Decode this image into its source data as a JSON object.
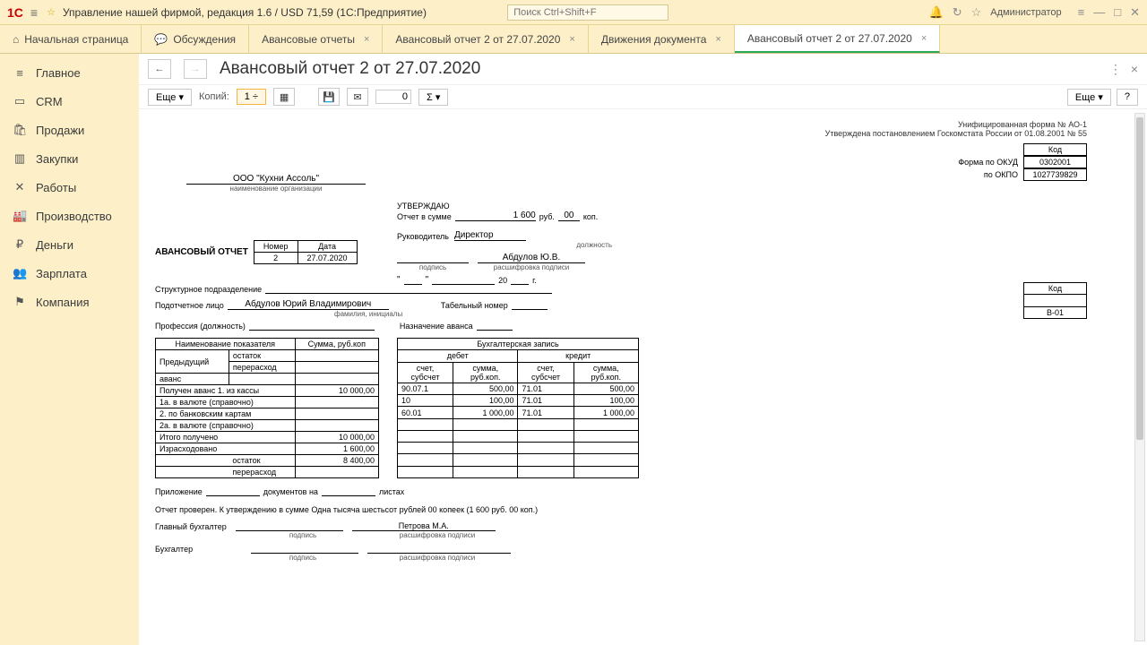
{
  "titlebar": {
    "app_title": "Управление нашей фирмой, редакция 1.6 / USD 71,59  (1С:Предприятие)",
    "search_placeholder": "Поиск Ctrl+Shift+F",
    "user": "Администратор"
  },
  "tabs": {
    "home": "Начальная страница",
    "chat": "Обсуждения",
    "t1": "Авансовые отчеты",
    "t2": "Авансовый отчет 2 от 27.07.2020",
    "t3": "Движения документа",
    "active": "Авансовый отчет 2 от 27.07.2020"
  },
  "sidebar": {
    "main": "Главное",
    "crm": "CRM",
    "sales": "Продажи",
    "purchases": "Закупки",
    "works": "Работы",
    "production": "Производство",
    "money": "Деньги",
    "salary": "Зарплата",
    "company": "Компания"
  },
  "doc": {
    "title": "Авансовый отчет 2 от 27.07.2020",
    "more": "Еще",
    "copies_label": "Копий:",
    "copies_value": "1",
    "zero": "0",
    "sigma": "Σ",
    "help": "?"
  },
  "report": {
    "form_num": "Унифицированная форма № АО-1",
    "form_approved": "Утверждена постановлением Госкомстата России от  01.08.2001 № 55",
    "code_label": "Код",
    "okud_label": "Форма по ОКУД",
    "okud": "0302001",
    "okpo_label": "по ОКПО",
    "okpo": "1027739829",
    "org": "ООО \"Кухни Ассоль\"",
    "org_caption": "наименование организации",
    "approve": "УТВЕРЖДАЮ",
    "sum_label": "Отчет в сумме",
    "sum_val": "1 600",
    "rub": "руб.",
    "kop_val": "00",
    "kop": "коп.",
    "boss_label": "Руководитель",
    "boss_pos": "Директор",
    "pos_caption": "должность",
    "sig_caption": "подпись",
    "decipher_caption": "расшифровка подписи",
    "boss_name": "Абдулов Ю.В.",
    "date20": "20",
    "date_g": "г.",
    "title_main": "АВАНСОВЫЙ ОТЧЕТ",
    "num_label": "Номер",
    "date_label": "Дата",
    "number": "2",
    "date": "27.07.2020",
    "struct_label": "Структурное подразделение",
    "person_label": "Подотчетное лицо",
    "person": "Абдулов Юрий Владимирович",
    "person_caption": "фамилия, инициалы",
    "tabnum_label": "Табельный номер",
    "tabnum": "В-01",
    "prof_label": "Профессия (должность)",
    "purpose_label": "Назначение аванса",
    "left_h1": "Наименование показателя",
    "left_h2": "Сумма, руб.коп",
    "prev": "Предыдущий",
    "prev_ost": "остаток",
    "prev_pere": "перерасход",
    "avans": "аванс",
    "row1": "Получен аванс 1. из кассы",
    "row1_val": "10 000,00",
    "row2": "1а. в валюте (справочно)",
    "row3": "2. по банковским картам",
    "row4": "2а. в валюте (справочно)",
    "row5": "Итого получено",
    "row5_val": "10 000,00",
    "row6": "Израсходовано",
    "row6_val": "1 600,00",
    "row7": "остаток",
    "row7_val": "8 400,00",
    "row8": "перерасход",
    "acc_h": "Бухгалтерская запись",
    "debit": "дебет",
    "credit": "кредит",
    "acc_sub": "счет, субсчет",
    "acc_sum": "сумма, руб.коп.",
    "d1_acc": "90.07.1",
    "d1_sum": "500,00",
    "c1_acc": "71.01",
    "c1_sum": "500,00",
    "d2_acc": "10",
    "d2_sum": "100,00",
    "c2_acc": "71.01",
    "c2_sum": "100,00",
    "d3_acc": "60.01",
    "d3_sum": "1 000,00",
    "c3_acc": "71.01",
    "c3_sum": "1 000,00",
    "attach_label": "Приложение",
    "docs_on": "документов на",
    "sheets": "листах",
    "checked": "Отчет проверен. К утверждению в сумме Одна тысяча шестьсот рублей 00 копеек (1 600 руб. 00 коп.)",
    "mainacc_label": "Главный бухгалтер",
    "mainacc_name": "Петрова М.А.",
    "acc_label": "Бухгалтер"
  }
}
